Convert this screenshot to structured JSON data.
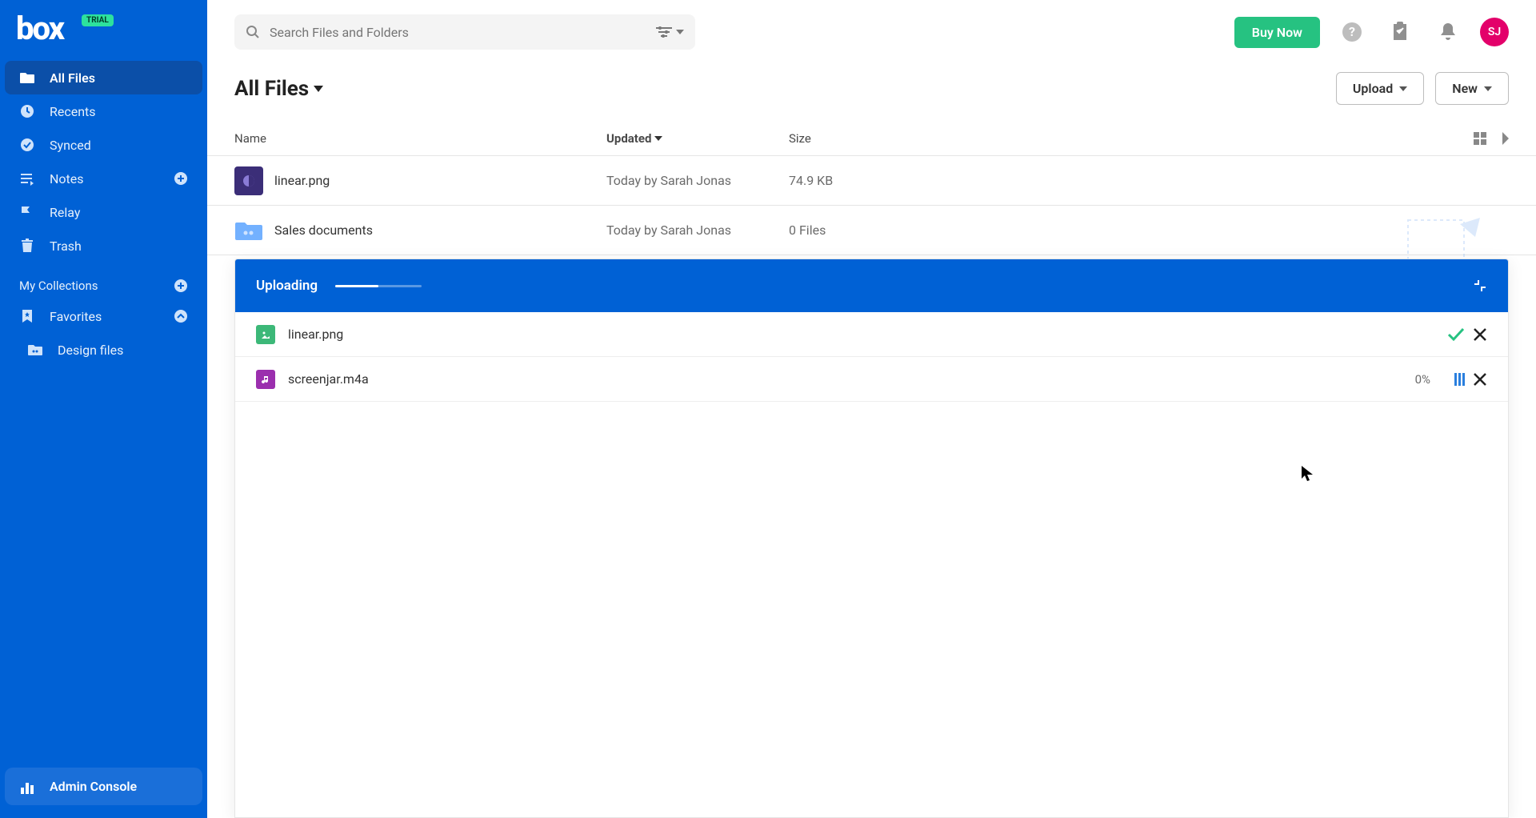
{
  "brand": {
    "name": "box",
    "badge": "TRIAL"
  },
  "sidebar": {
    "items": [
      {
        "label": "All Files",
        "active": true
      },
      {
        "label": "Recents"
      },
      {
        "label": "Synced"
      },
      {
        "label": "Notes"
      },
      {
        "label": "Relay"
      },
      {
        "label": "Trash"
      }
    ],
    "collections_label": "My Collections",
    "favorites_label": "Favorites",
    "favorite_items": [
      {
        "label": "Design files"
      }
    ],
    "admin_label": "Admin Console"
  },
  "search": {
    "placeholder": "Search Files and Folders"
  },
  "header": {
    "buy_label": "Buy Now",
    "avatar_initials": "SJ"
  },
  "page": {
    "title": "All Files",
    "upload_btn": "Upload",
    "new_btn": "New"
  },
  "columns": {
    "name": "Name",
    "updated": "Updated",
    "size": "Size"
  },
  "files": [
    {
      "name": "linear.png",
      "updated": "Today by Sarah Jonas",
      "size": "74.9 KB",
      "icon_bg": "#3b2e78",
      "type": "image"
    },
    {
      "name": "Sales documents",
      "updated": "Today by Sarah Jonas",
      "size": "0 Files",
      "icon_bg": "#6ea8ff",
      "type": "folder"
    }
  ],
  "upload_panel": {
    "title": "Uploading",
    "progress_pct": 50,
    "items": [
      {
        "name": "linear.png",
        "icon_bg": "#3cb878",
        "status": "done"
      },
      {
        "name": "screenjar.m4a",
        "icon_bg": "#9b2fae",
        "status": "progress",
        "pct": "0%"
      }
    ]
  }
}
